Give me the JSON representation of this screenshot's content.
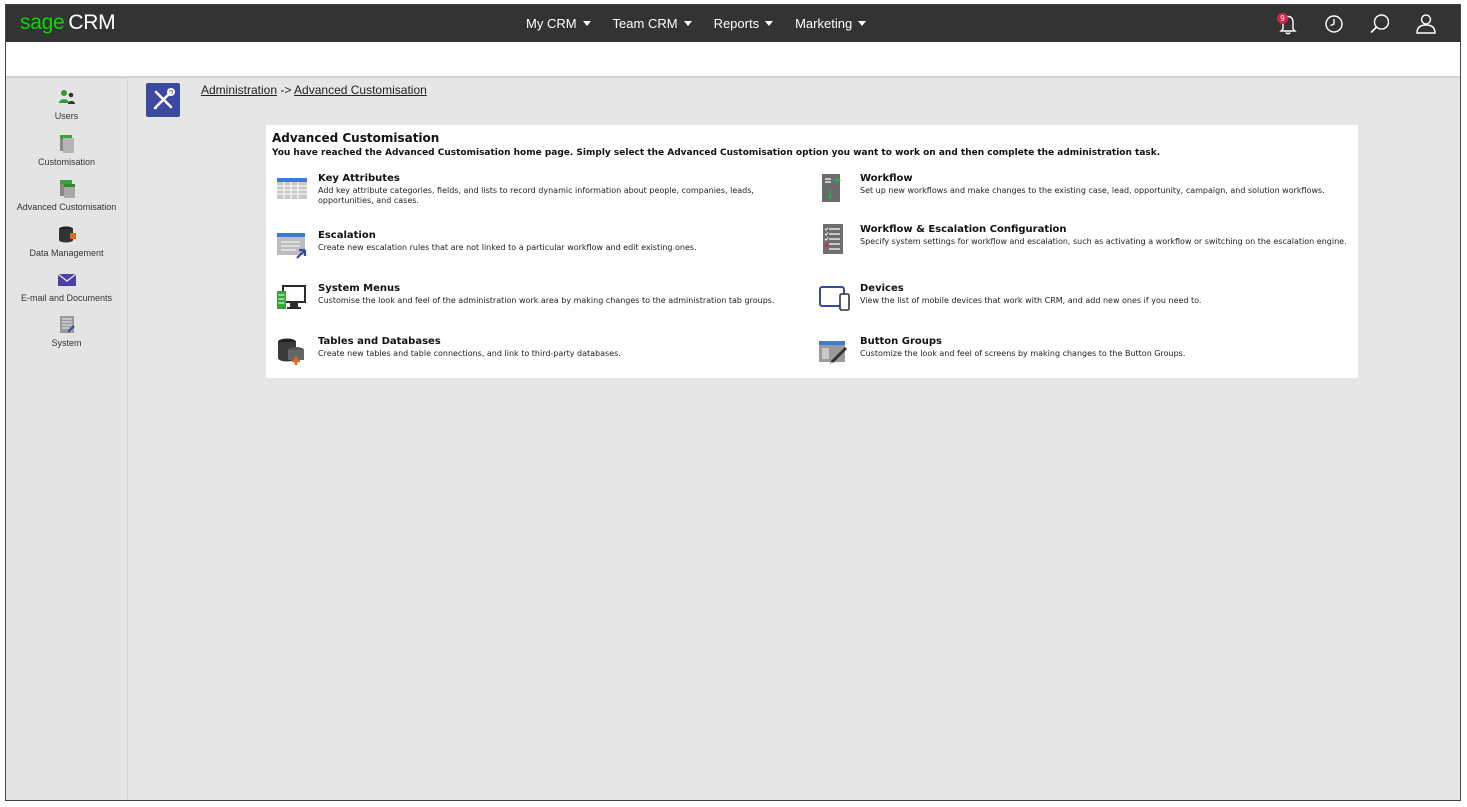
{
  "app": {
    "brand": "sage",
    "product": "CRM"
  },
  "nav": [
    {
      "label": "My CRM"
    },
    {
      "label": "Team CRM"
    },
    {
      "label": "Reports"
    },
    {
      "label": "Marketing"
    }
  ],
  "tools": {
    "notifications_count": "9",
    "icons": [
      "bell-icon",
      "clock-icon",
      "search-icon",
      "user-icon"
    ]
  },
  "sidebar": {
    "items": [
      {
        "label": "Users",
        "icon": "users-icon"
      },
      {
        "label": "Customisation",
        "icon": "customisation-icon"
      },
      {
        "label": "Advanced Customisation",
        "icon": "advanced-customisation-icon"
      },
      {
        "label": "Data Management",
        "icon": "data-management-icon"
      },
      {
        "label": "E-mail and Documents",
        "icon": "email-icon"
      },
      {
        "label": "System",
        "icon": "system-icon"
      }
    ]
  },
  "breadcrumb": {
    "root": "Administration",
    "separator": " -> ",
    "current": "Advanced Customisation"
  },
  "panel": {
    "title": "Advanced Customisation",
    "subtitle": "You have reached the Advanced Customisation home page. Simply select the Advanced Customisation option you want to work on and then complete the administration task.",
    "options": [
      {
        "title": "Key Attributes",
        "desc": "Add key attribute categories, fields, and lists to record dynamic information about people, companies, leads, opportunities, and cases.",
        "icon": "key-attributes-icon"
      },
      {
        "title": "Workflow",
        "desc": "Set up new workflows and make changes to the existing case, lead, opportunity, campaign, and solution workflows.",
        "icon": "workflow-icon"
      },
      {
        "title": "Escalation",
        "desc": "Create new escalation rules that are not linked to a particular workflow and edit existing ones.",
        "icon": "escalation-icon"
      },
      {
        "title": "Workflow & Escalation Configuration",
        "desc": "Specify system settings for workflow and escalation, such as activating a workflow or switching on the escalation engine.",
        "icon": "workflow-escalation-config-icon"
      },
      {
        "title": "System Menus",
        "desc": "Customise the look and feel of the administration work area by making changes to the administration tab groups.",
        "icon": "system-menus-icon"
      },
      {
        "title": "Devices",
        "desc": "View the list of mobile devices that work with CRM, and add new ones if you need to.",
        "icon": "devices-icon"
      },
      {
        "title": "Tables and Databases",
        "desc": "Create new tables and table connections, and link to third-party databases.",
        "icon": "tables-databases-icon"
      },
      {
        "title": "Button Groups",
        "desc": "Customize the look and feel of screens by making changes to the Button Groups.",
        "icon": "button-groups-icon"
      }
    ]
  },
  "colors": {
    "topbar": "#333333",
    "brand_green": "#00dc00",
    "accent_blue": "#3b4aa0",
    "badge_red": "#d6224a"
  }
}
